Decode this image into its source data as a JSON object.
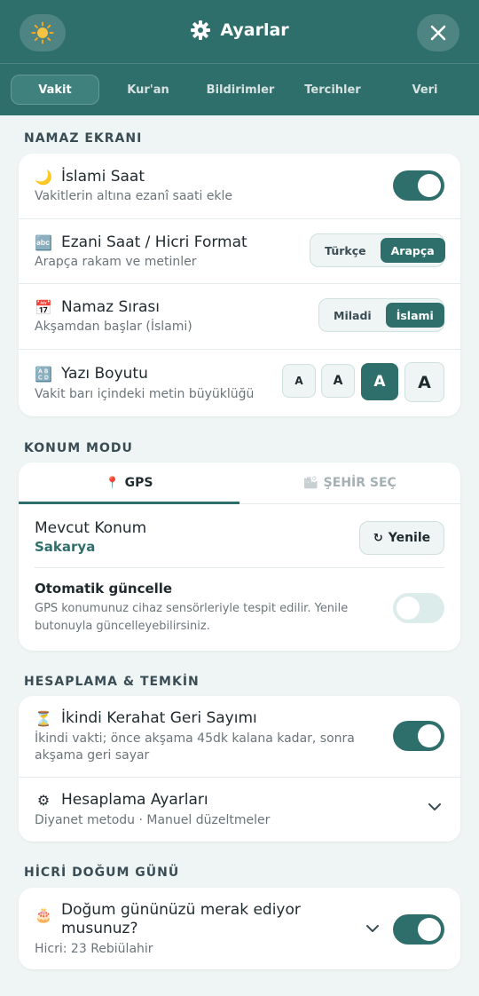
{
  "header": {
    "title": "Ayarlar",
    "tabs": [
      "Vakit",
      "Kur'an",
      "Bildirimler",
      "Tercihler",
      "Veri"
    ],
    "active_tab": "Vakit",
    "accent": "#2f6f6b"
  },
  "namaz": {
    "section": "NAMAZ EKRANI",
    "islami_saat": {
      "title": "İslami Saat",
      "sub": "Vakitlerin altına ezanî saati ekle",
      "on": true
    },
    "ezani": {
      "title": "Ezani Saat / Hicri Format",
      "sub": "Arapça rakam ve metinler",
      "opt1": "Türkçe",
      "opt2": "Arapça",
      "selected": "Arapça"
    },
    "sira": {
      "title": "Namaz Sırası",
      "sub": "Akşamdan başlar (İslami)",
      "opt1": "Miladi",
      "opt2": "İslami",
      "selected": "İslami"
    },
    "boyut": {
      "title": "Yazı Boyutu",
      "sub": "Vakit barı içindeki metin büyüklüğü",
      "options": [
        "A",
        "A",
        "A",
        "A"
      ],
      "selected_index": 2
    }
  },
  "konum": {
    "section": "KONUM MODU",
    "tab_gps": "GPS",
    "tab_sehir": "ŞEHİR SEÇ",
    "active": "GPS",
    "mevcut_title": "Mevcut Konum",
    "mevcut_value": "Sakarya",
    "refresh_label": "Yenile",
    "oto_title": "Otomatik güncelle",
    "oto_sub1": "GPS konumunuz cihaz sensörleriyle tespit edilir. Yenile",
    "oto_sub2": "butonuyla güncelleyebilirsiniz.",
    "oto_on": false
  },
  "hesap": {
    "section": "HESAPLAMA & TEMKİN",
    "kerahat_title": "İkindi Kerahat Geri Sayımı",
    "kerahat_sub1": "İkindi vakti; önce akşama 45dk kalana kadar, sonra",
    "kerahat_sub2": "akşama geri sayar",
    "kerahat_on": true,
    "ayar_title": "Hesaplama Ayarları",
    "ayar_sub": "Diyanet metodu · Manuel düzeltmeler"
  },
  "dogum": {
    "section": "HİCRİ DOĞUM GÜNÜ",
    "title1": "Doğum gününüzü merak ediyor",
    "title2": "musunuz?",
    "sub": "Hicri: 23 Rebiülahir",
    "on": true
  }
}
